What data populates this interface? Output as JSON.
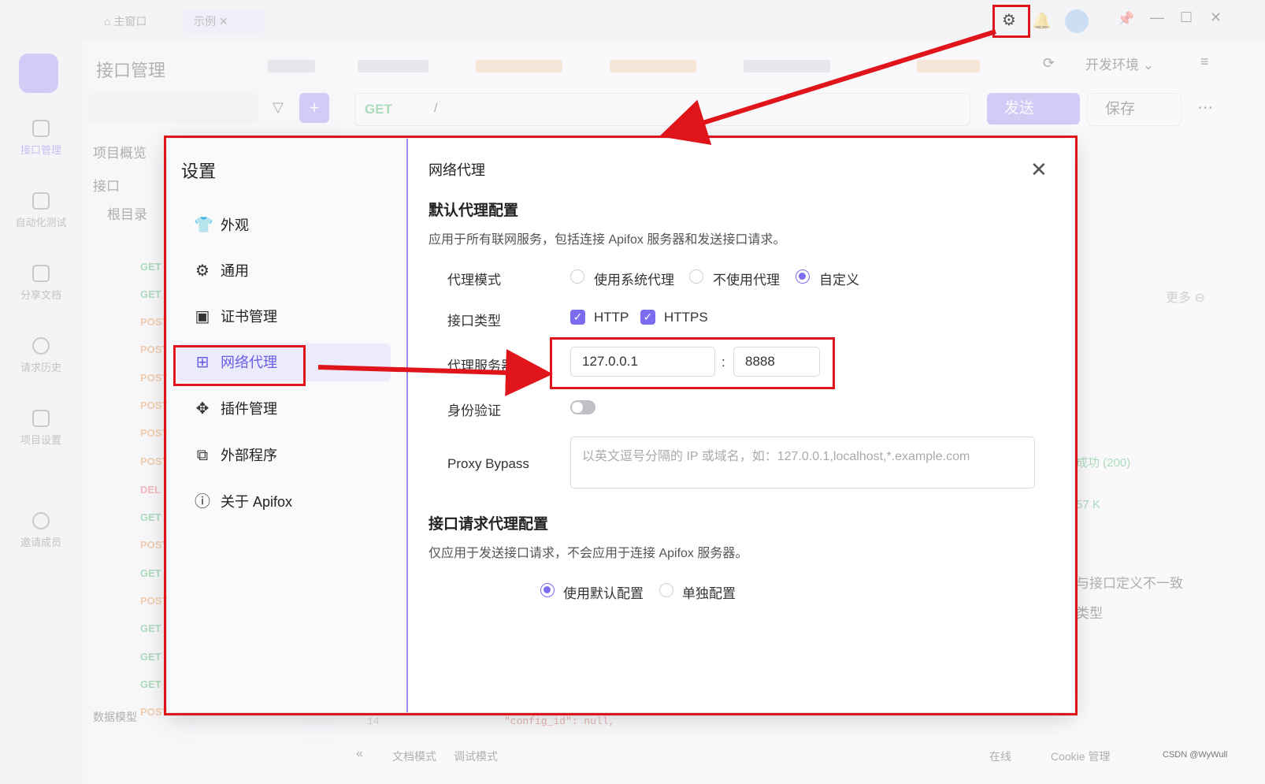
{
  "app": {
    "tabs": [
      "主窗口",
      "示例"
    ],
    "page_title": "接口管理",
    "environment": "开发环境",
    "method": "GET",
    "url": "/",
    "send": "发送",
    "save": "保存",
    "nav": [
      "接口管理",
      "自动化测试",
      "分享文档",
      "请求历史",
      "项目设置",
      "邀请成员"
    ],
    "tree": {
      "overview": "项目概览",
      "api": "接口",
      "root": "根目录"
    },
    "methods": [
      "GET",
      "GET",
      "POST",
      "POST",
      "POST",
      "POST",
      "POST",
      "POST",
      "DEL",
      "GET",
      "POST",
      "GET",
      "POST",
      "GET",
      "GET",
      "GET",
      "POST"
    ],
    "more": "更多",
    "resp_status": "成功 (200)",
    "resp_size": "57 K",
    "warn1": "与接口定义不一致",
    "warn2": "类型",
    "code_line": "14",
    "code_text": "\"config_id\": null,",
    "bottom": {
      "data_model": "数据模型",
      "doc_mode": "文档模式",
      "debug_mode": "调试模式",
      "online": "在线",
      "cookie": "Cookie 管理",
      "watermark": "CSDN @WyWull"
    }
  },
  "dialog": {
    "title": "设置",
    "menu": [
      {
        "label": "外观",
        "icon": "shirt-icon"
      },
      {
        "label": "通用",
        "icon": "gear-icon"
      },
      {
        "label": "证书管理",
        "icon": "certificate-icon"
      },
      {
        "label": "网络代理",
        "icon": "network-icon"
      },
      {
        "label": "插件管理",
        "icon": "puzzle-icon"
      },
      {
        "label": "外部程序",
        "icon": "copy-icon"
      },
      {
        "label": "关于 Apifox",
        "icon": "info-icon"
      }
    ],
    "active_index": 3,
    "section_title": "网络代理",
    "default": {
      "heading": "默认代理配置",
      "desc": "应用于所有联网服务，包括连接 Apifox 服务器和发送接口请求。",
      "mode_label": "代理模式",
      "mode_options": [
        "使用系统代理",
        "不使用代理",
        "自定义"
      ],
      "mode_selected": "自定义",
      "type_label": "接口类型",
      "types": [
        "HTTP",
        "HTTPS"
      ],
      "server_label": "代理服务器",
      "host": "127.0.0.1",
      "separator": ":",
      "port": "8888",
      "auth_label": "身份验证",
      "auth_on": false,
      "bypass_label": "Proxy Bypass",
      "bypass_placeholder": "以英文逗号分隔的 IP 或域名，如：127.0.0.1,localhost,*.example.com"
    },
    "request": {
      "heading": "接口请求代理配置",
      "desc": "仅应用于发送接口请求，不会应用于连接 Apifox 服务器。",
      "options": [
        "使用默认配置",
        "单独配置"
      ],
      "selected": "使用默认配置"
    }
  },
  "colors": {
    "accent": "#7c6cf0",
    "annotation": "#e0151b"
  }
}
